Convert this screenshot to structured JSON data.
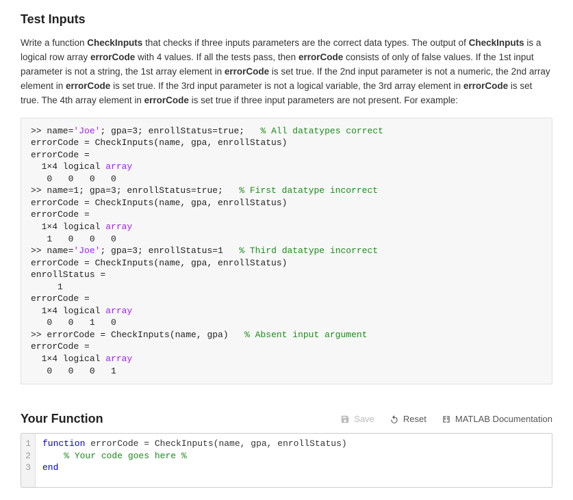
{
  "title": "Test Inputs",
  "desc_html": "Write a function <b>CheckInputs</b> that checks if three inputs parameters are the correct data types. The output of <b>CheckInputs</b> is a logical row array <b>errorCode</b> with 4 values. If all the tests pass, then <b>errorCode</b> consists of only of false values.   If the 1st input parameter is not a string, the 1st array element in <b>errorCode</b> is set true.   If the 2nd input parameter is not a numeric, the 2nd array element in <b>errorCode</b> is set true.  If the 3rd input parameter is not a logical variable, the 3rd array element in <b>errorCode</b> is set true.  The 4th array element in <b>errorCode</b> is set true if three input parameters are not present.  For example:",
  "example_lines": [
    {
      "segs": [
        {
          "t": ">> name="
        },
        {
          "t": "'Joe'",
          "c": "str"
        },
        {
          "t": "; gpa=3; enrollStatus=true;   "
        },
        {
          "t": "% All datatypes correct",
          "c": "comment"
        }
      ]
    },
    {
      "segs": [
        {
          "t": "errorCode = CheckInputs(name, gpa, enrollStatus)"
        }
      ]
    },
    {
      "segs": [
        {
          "t": "errorCode ="
        }
      ]
    },
    {
      "segs": [
        {
          "t": "  1×4 logical "
        },
        {
          "t": "array",
          "c": "kw"
        }
      ]
    },
    {
      "segs": [
        {
          "t": "   0   0   0   0"
        }
      ]
    },
    {
      "segs": [
        {
          "t": ">> name=1; gpa=3; enrollStatus=true;   "
        },
        {
          "t": "% First datatype incorrect",
          "c": "comment"
        }
      ]
    },
    {
      "segs": [
        {
          "t": "errorCode = CheckInputs(name, gpa, enrollStatus)"
        }
      ]
    },
    {
      "segs": [
        {
          "t": "errorCode ="
        }
      ]
    },
    {
      "segs": [
        {
          "t": "  1×4 logical "
        },
        {
          "t": "array",
          "c": "kw"
        }
      ]
    },
    {
      "segs": [
        {
          "t": "   1   0   0   0"
        }
      ]
    },
    {
      "segs": [
        {
          "t": ">> name="
        },
        {
          "t": "'Joe'",
          "c": "str"
        },
        {
          "t": "; gpa=3; enrollStatus=1   "
        },
        {
          "t": "% Third datatype incorrect",
          "c": "comment"
        }
      ]
    },
    {
      "segs": [
        {
          "t": "errorCode = CheckInputs(name, gpa, enrollStatus)"
        }
      ]
    },
    {
      "segs": [
        {
          "t": "enrollStatus ="
        }
      ]
    },
    {
      "segs": [
        {
          "t": "     1"
        }
      ]
    },
    {
      "segs": [
        {
          "t": "errorCode ="
        }
      ]
    },
    {
      "segs": [
        {
          "t": "  1×4 logical "
        },
        {
          "t": "array",
          "c": "kw"
        }
      ]
    },
    {
      "segs": [
        {
          "t": "   0   0   1   0"
        }
      ]
    },
    {
      "segs": [
        {
          "t": ">> errorCode = CheckInputs(name, gpa)   "
        },
        {
          "t": "% Absent input argument",
          "c": "comment"
        }
      ]
    },
    {
      "segs": [
        {
          "t": "errorCode ="
        }
      ]
    },
    {
      "segs": [
        {
          "t": "  1×4 logical "
        },
        {
          "t": "array",
          "c": "kw"
        }
      ]
    },
    {
      "segs": [
        {
          "t": "   0   0   0   1"
        }
      ]
    }
  ],
  "your_function_title": "Your Function",
  "toolbar": {
    "save": "Save",
    "reset": "Reset",
    "docs": "MATLAB Documentation"
  },
  "editor_lines": [
    {
      "n": 1,
      "segs": [
        {
          "t": "function",
          "c": "fnkw"
        },
        {
          "t": " errorCode = CheckInputs(name, gpa, enrollStatus)"
        }
      ]
    },
    {
      "n": 2,
      "segs": [
        {
          "t": "    "
        },
        {
          "t": "% Your code goes here %",
          "c": "comment"
        }
      ]
    },
    {
      "n": 3,
      "segs": [
        {
          "t": "end",
          "c": "fnkw"
        }
      ]
    }
  ]
}
